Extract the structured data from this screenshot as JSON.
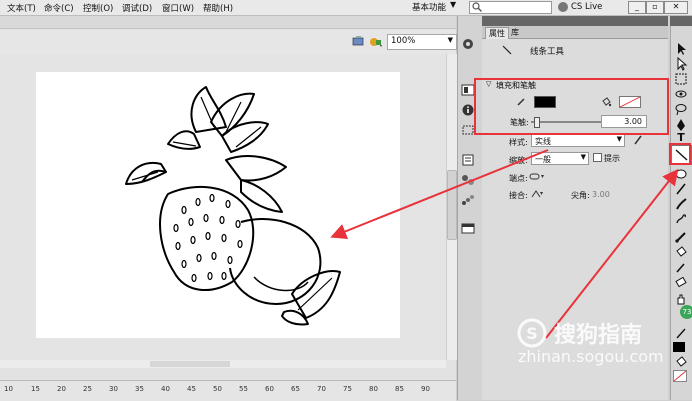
{
  "menu": {
    "items": [
      "文本(T)",
      "命令(C)",
      "控制(O)",
      "调试(D)",
      "窗口(W)",
      "帮助(H)"
    ],
    "workspace": "基本功能",
    "cslive": "CS Live",
    "window_buttons": [
      "_",
      "▫",
      "✕"
    ]
  },
  "stage": {
    "zoom": "100%",
    "ruler_numbers": [
      "10",
      "15",
      "20",
      "25",
      "30",
      "35",
      "40",
      "45",
      "50",
      "55",
      "60",
      "65",
      "70",
      "75",
      "80",
      "85",
      "90"
    ]
  },
  "panel": {
    "tabs": [
      "属性",
      "库"
    ],
    "tool_name": "线条工具",
    "section_title": "填充和笔触",
    "stroke_label": "笔触:",
    "stroke_value": "3.00",
    "style_label": "样式:",
    "style_value": "实线",
    "scale_label": "缩放:",
    "scale_value": "一般",
    "hint_label": "提示",
    "cap_label": "端点:",
    "join_label": "接合:",
    "miter_label": "尖角:",
    "miter_value": "3.00"
  },
  "colors": {
    "stroke_color": "#000000",
    "fill_color": "#ffffff",
    "annotation": "#e8333a"
  },
  "watermark": {
    "logo_glyph": "S",
    "text": "搜狗指南",
    "url": "zhinan.sogou.com",
    "badge": "73"
  }
}
